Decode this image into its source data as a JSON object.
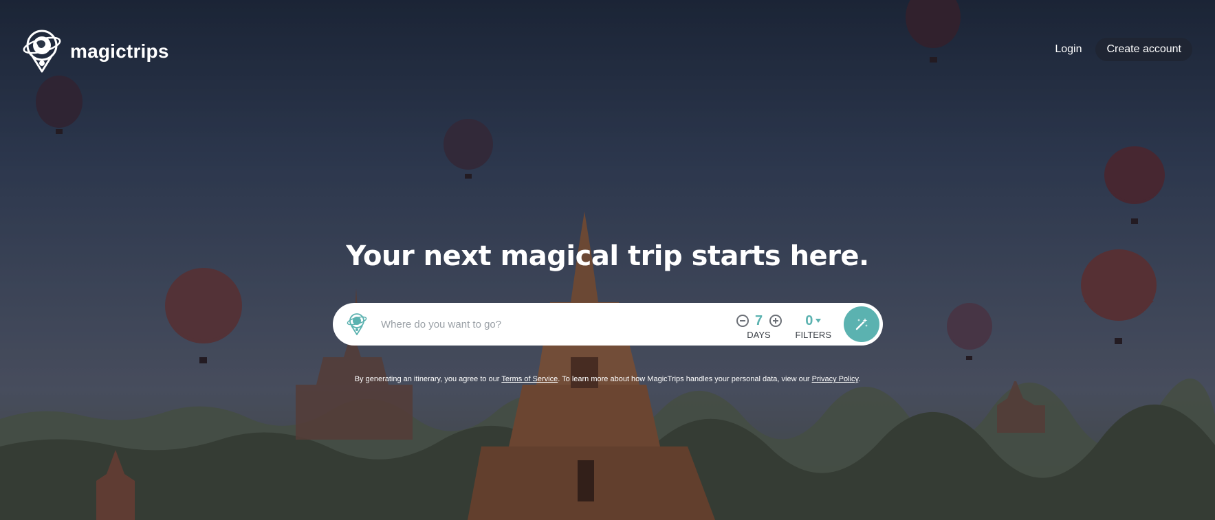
{
  "brand": {
    "name": "magictrips"
  },
  "header": {
    "login_label": "Login",
    "create_account_label": "Create account"
  },
  "hero": {
    "title": "Your next magical trip starts here."
  },
  "search": {
    "placeholder": "Where do you want to go?",
    "value": "",
    "days_value": "7",
    "days_label": "DAYS",
    "filters_value": "0",
    "filters_label": "FILTERS"
  },
  "disclaimer": {
    "prefix": "By generating an itinerary, you agree to our ",
    "terms_link": "Terms of Service",
    "middle": ". To learn more about how MagicTrips handles your personal data, view our ",
    "privacy_link": "Privacy Policy",
    "suffix": "."
  },
  "colors": {
    "accent": "#5bb2b0",
    "button_dark": "#1f2533",
    "text_white": "#ffffff"
  },
  "icons": {
    "logo": "globe-pin-icon",
    "search": "globe-pin-icon",
    "generate": "magic-wand-icon",
    "decrement": "minus-circle-icon",
    "increment": "plus-circle-icon",
    "filters_dropdown": "caret-down-icon"
  }
}
